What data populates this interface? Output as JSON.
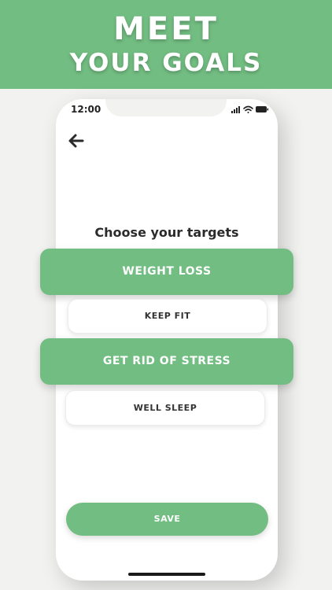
{
  "banner": {
    "line1": "MEET",
    "line2": "YOUR GOALS"
  },
  "status_bar": {
    "time": "12:00",
    "icons": [
      "cellular-signal-icon",
      "wifi-icon",
      "battery-icon"
    ]
  },
  "nav": {
    "back_icon": "arrow-left-icon"
  },
  "screen": {
    "title": "Choose your targets",
    "options": [
      {
        "label": "WEIGHT LOSS",
        "selected": true
      },
      {
        "label": "KEEP FIT",
        "selected": false
      },
      {
        "label": "GET RID OF STRESS",
        "selected": true
      },
      {
        "label": "WELL SLEEP",
        "selected": false
      }
    ],
    "save_label": "SAVE"
  },
  "colors": {
    "accent": "#72bd82",
    "background": "#f2f2f0",
    "text": "#2b2b2b"
  }
}
